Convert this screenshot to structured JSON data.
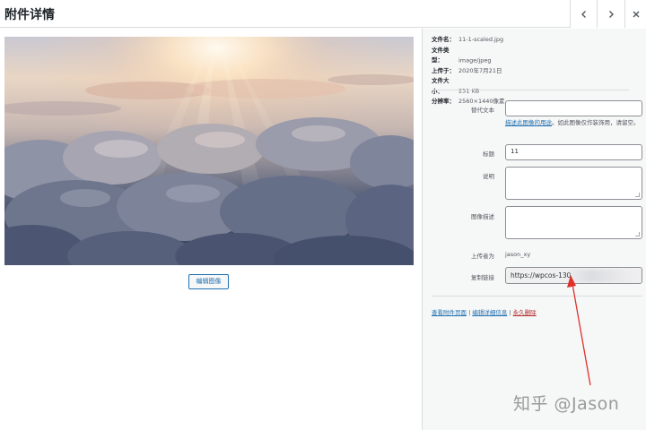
{
  "header": {
    "title": "附件详情",
    "prev_icon": "chevron-left-icon",
    "next_icon": "chevron-right-icon",
    "close_icon": "close-icon"
  },
  "image": {
    "edit_button_label": "编辑图像"
  },
  "file_info": {
    "filename_label": "文件名：",
    "filename_value": "11-1-scaled.jpg",
    "type_label": "文件类型：",
    "type_value": "image/jpeg",
    "uploaded_label": "上传于：",
    "uploaded_value": "2020年7月21日",
    "size_label": "文件大小：",
    "size_value": "251 KB",
    "dims_label": "分辨率：",
    "dims_value": "2560×1440像素"
  },
  "fields": {
    "alt_label": "替代文本",
    "alt_value": "",
    "alt_help_link": "描述此图像的用途",
    "alt_help_rest": "。如此图像仅作装饰用，请留空。",
    "title_label": "标题",
    "title_value": "11",
    "caption_label": "说明",
    "caption_value": "",
    "description_label": "图像描述",
    "description_value": "",
    "uploaded_by_label": "上传者为",
    "uploaded_by_value": "jason_xy",
    "copy_link_label": "复制链接",
    "copy_link_value": "https://wpcos-130"
  },
  "actions": {
    "view_page": "查看附件页面",
    "sep1": " | ",
    "edit_details": "编辑详细信息",
    "sep2": " | ",
    "delete": "永久删除"
  },
  "watermark": {
    "text": "知乎 @Jason"
  },
  "colors": {
    "link": "#2271b1",
    "delete": "#b32d2e",
    "arrow": "#e0312b"
  }
}
